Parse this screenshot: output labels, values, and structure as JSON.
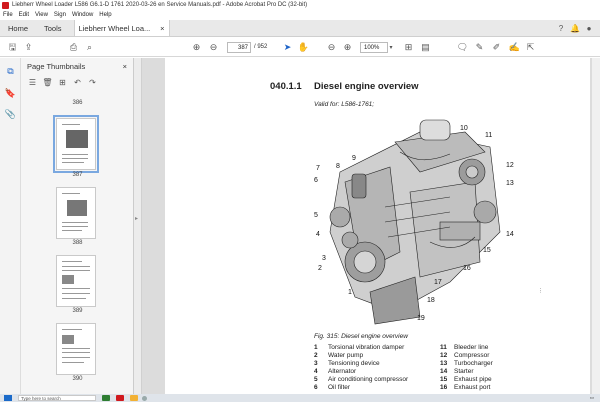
{
  "window": {
    "title": "Liebherr Wheel Loader L586 G6.1-D 1761 2020-03-26 en Service Manuals.pdf - Adobe Acrobat Pro DC (32-bit)"
  },
  "menu": [
    "File",
    "Edit",
    "View",
    "Sign",
    "Window",
    "Help"
  ],
  "tabs": {
    "home": "Home",
    "tools": "Tools",
    "document": "Liebherr Wheel Loa...",
    "close": "×"
  },
  "toolbar": {
    "current_page": "387",
    "total_pages": "/ 952",
    "zoom": "100%"
  },
  "thumbnails_panel": {
    "title": "Page Thumbnails",
    "close": "×",
    "pages": [
      "386",
      "387",
      "388",
      "389",
      "390"
    ]
  },
  "document": {
    "section_number": "040.1.1",
    "section_title": "Diesel engine overview",
    "valid_for": "Valid for: L586-1761;",
    "caption": "Fig. 315: Diesel engine overview",
    "callouts": [
      "1",
      "2",
      "3",
      "4",
      "5",
      "6",
      "7",
      "8",
      "9",
      "10",
      "11",
      "12",
      "13",
      "14",
      "15",
      "16",
      "17",
      "18",
      "19"
    ],
    "legend_left": [
      {
        "num": "1",
        "text": "Torsional vibration damper"
      },
      {
        "num": "2",
        "text": "Water pump"
      },
      {
        "num": "3",
        "text": "Tensioning device"
      },
      {
        "num": "4",
        "text": "Alternator"
      },
      {
        "num": "5",
        "text": "Air conditioning compressor"
      },
      {
        "num": "6",
        "text": "Oil filter"
      }
    ],
    "legend_right": [
      {
        "num": "11",
        "text": "Bleeder line"
      },
      {
        "num": "12",
        "text": "Compressor"
      },
      {
        "num": "13",
        "text": "Turbocharger"
      },
      {
        "num": "14",
        "text": "Starter"
      },
      {
        "num": "15",
        "text": "Exhaust pipe"
      },
      {
        "num": "16",
        "text": "Exhaust port"
      }
    ]
  },
  "taskbar": {
    "search_placeholder": "Type here to search"
  }
}
